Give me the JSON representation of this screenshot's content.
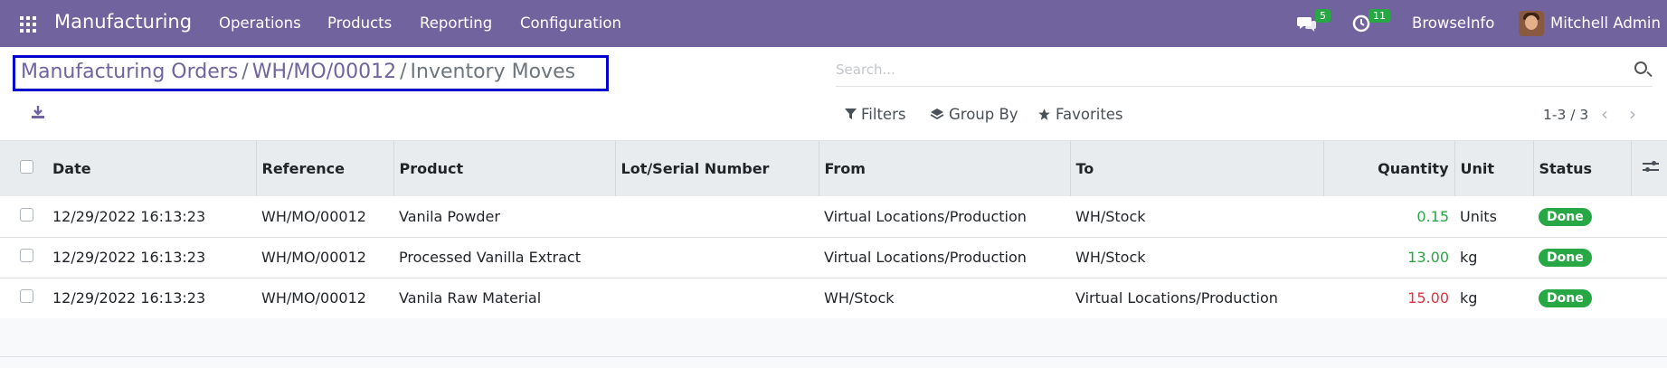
{
  "navbar": {
    "app_name": "Manufacturing",
    "menu": [
      "Operations",
      "Products",
      "Reporting",
      "Configuration"
    ],
    "messages_count": "5",
    "activities_count": "11",
    "company": "BrowseInfo",
    "user": "Mitchell Admin"
  },
  "breadcrumb": {
    "items": [
      "Manufacturing Orders",
      "WH/MO/00012"
    ],
    "current": "Inventory Moves",
    "separator": "/"
  },
  "search": {
    "placeholder": "Search..."
  },
  "filters": {
    "filters_label": "Filters",
    "group_by_label": "Group By",
    "favorites_label": "Favorites"
  },
  "pager": {
    "text": "1-3 / 3"
  },
  "table": {
    "headers": [
      "Date",
      "Reference",
      "Product",
      "Lot/Serial Number",
      "From",
      "To",
      "Quantity",
      "Unit",
      "Status"
    ],
    "rows": [
      {
        "date": "12/29/2022 16:13:23",
        "reference": "WH/MO/00012",
        "product": "Vanila Powder",
        "lot": "",
        "from": "Virtual Locations/Production",
        "to": "WH/Stock",
        "quantity": "0.15",
        "unit": "Units",
        "status": "Done",
        "qty_color": "#28a745"
      },
      {
        "date": "12/29/2022 16:13:23",
        "reference": "WH/MO/00012",
        "product": "Processed Vanilla Extract",
        "lot": "",
        "from": "Virtual Locations/Production",
        "to": "WH/Stock",
        "quantity": "13.00",
        "unit": "kg",
        "status": "Done",
        "qty_color": "#28a745"
      },
      {
        "date": "12/29/2022 16:13:23",
        "reference": "WH/MO/00012",
        "product": "Vanila Raw Material",
        "lot": "",
        "from": "WH/Stock",
        "to": "Virtual Locations/Production",
        "quantity": "15.00",
        "unit": "kg",
        "status": "Done",
        "qty_color": "#dc3545"
      }
    ]
  },
  "colors": {
    "navbar": "#71639e",
    "done_badge": "#28a745",
    "negative_qty": "#dc3545",
    "highlight_box": "#0000cc"
  }
}
